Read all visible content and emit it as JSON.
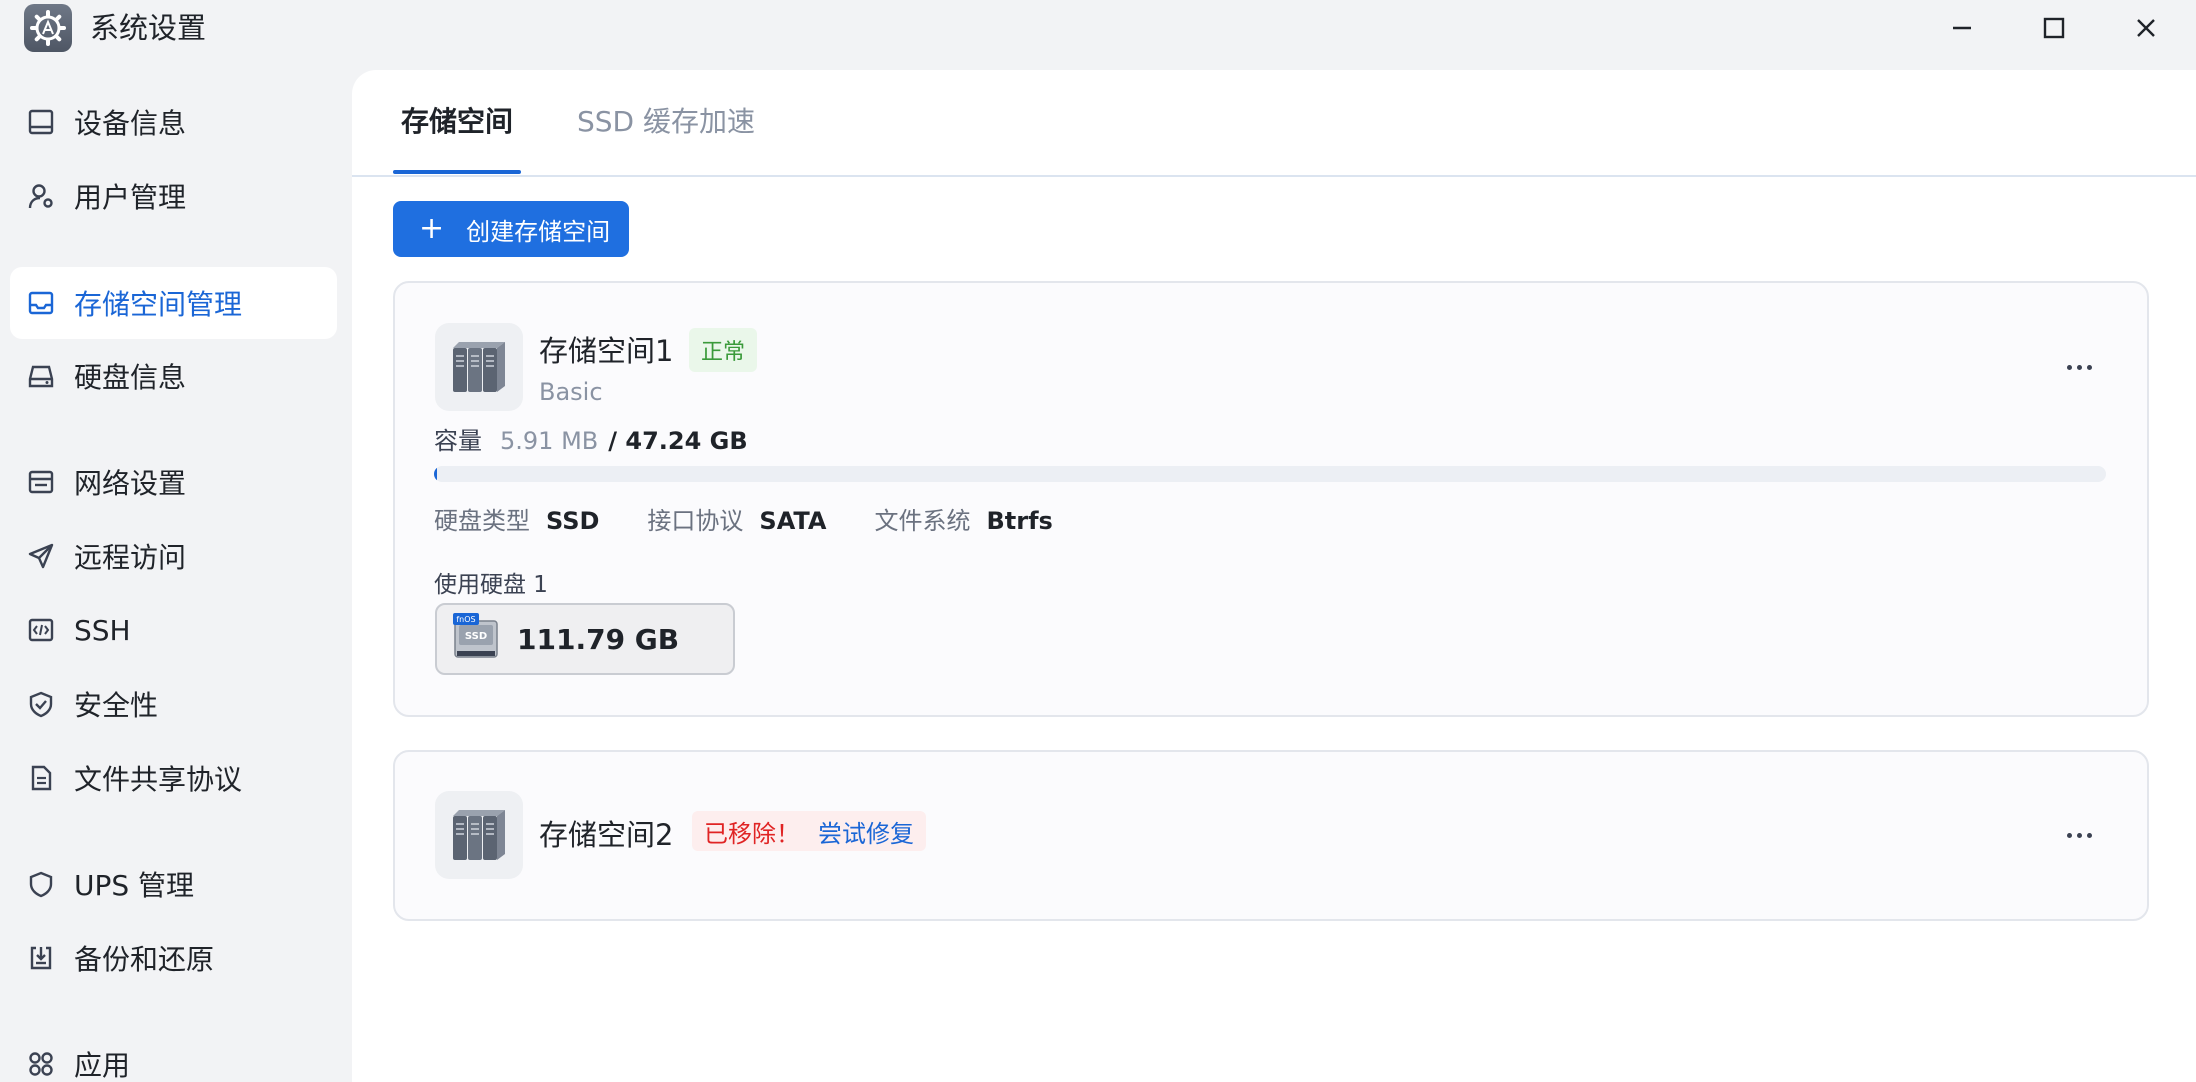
{
  "window": {
    "title": "系统设置",
    "controls": {
      "minimize": "minimize-icon",
      "maximize": "maximize-icon",
      "close": "close-icon"
    }
  },
  "sidebar": {
    "items": [
      {
        "label": "设备信息",
        "icon": "monitor-icon"
      },
      {
        "label": "用户管理",
        "icon": "user-gear-icon"
      },
      {
        "label": "存储空间管理",
        "icon": "storage-icon",
        "active": true
      },
      {
        "label": "硬盘信息",
        "icon": "hard-drive-icon"
      },
      {
        "label": "网络设置",
        "icon": "network-icon"
      },
      {
        "label": "远程访问",
        "icon": "send-icon"
      },
      {
        "label": "SSH",
        "icon": "code-icon"
      },
      {
        "label": "安全性",
        "icon": "shield-check-icon"
      },
      {
        "label": "文件共享协议",
        "icon": "file-icon"
      },
      {
        "label": "UPS 管理",
        "icon": "shield-icon"
      },
      {
        "label": "备份和还原",
        "icon": "backup-icon"
      },
      {
        "label": "应用",
        "icon": "apps-icon"
      }
    ]
  },
  "tabs": [
    {
      "label": "存储空间",
      "active": true
    },
    {
      "label": "SSD 缓存加速",
      "active": false
    }
  ],
  "create_button": {
    "icon": "plus-icon",
    "label": "创建存储空间"
  },
  "volumes": [
    {
      "name": "存储空间1",
      "status": "正常",
      "type": "Basic",
      "capacity_label": "容量",
      "used": "5.91 MB",
      "total": "/ 47.24 GB",
      "usage_fraction": 0.0001,
      "disk_type_label": "硬盘类型",
      "disk_type": "SSD",
      "interface_label": "接口协议",
      "interface": "SATA",
      "fs_label": "文件系统",
      "fs": "Btrfs",
      "disks_label": "使用硬盘 1",
      "disk_size": "111.79 GB",
      "disk_icon_text": "SSD",
      "disk_badge_text": "fnOS"
    },
    {
      "name": "存储空间2",
      "status": "已移除！",
      "repair": "尝试修复"
    }
  ],
  "colors": {
    "accent": "#1a66d6",
    "ok": "#3a9a3a",
    "error": "#e02424"
  }
}
